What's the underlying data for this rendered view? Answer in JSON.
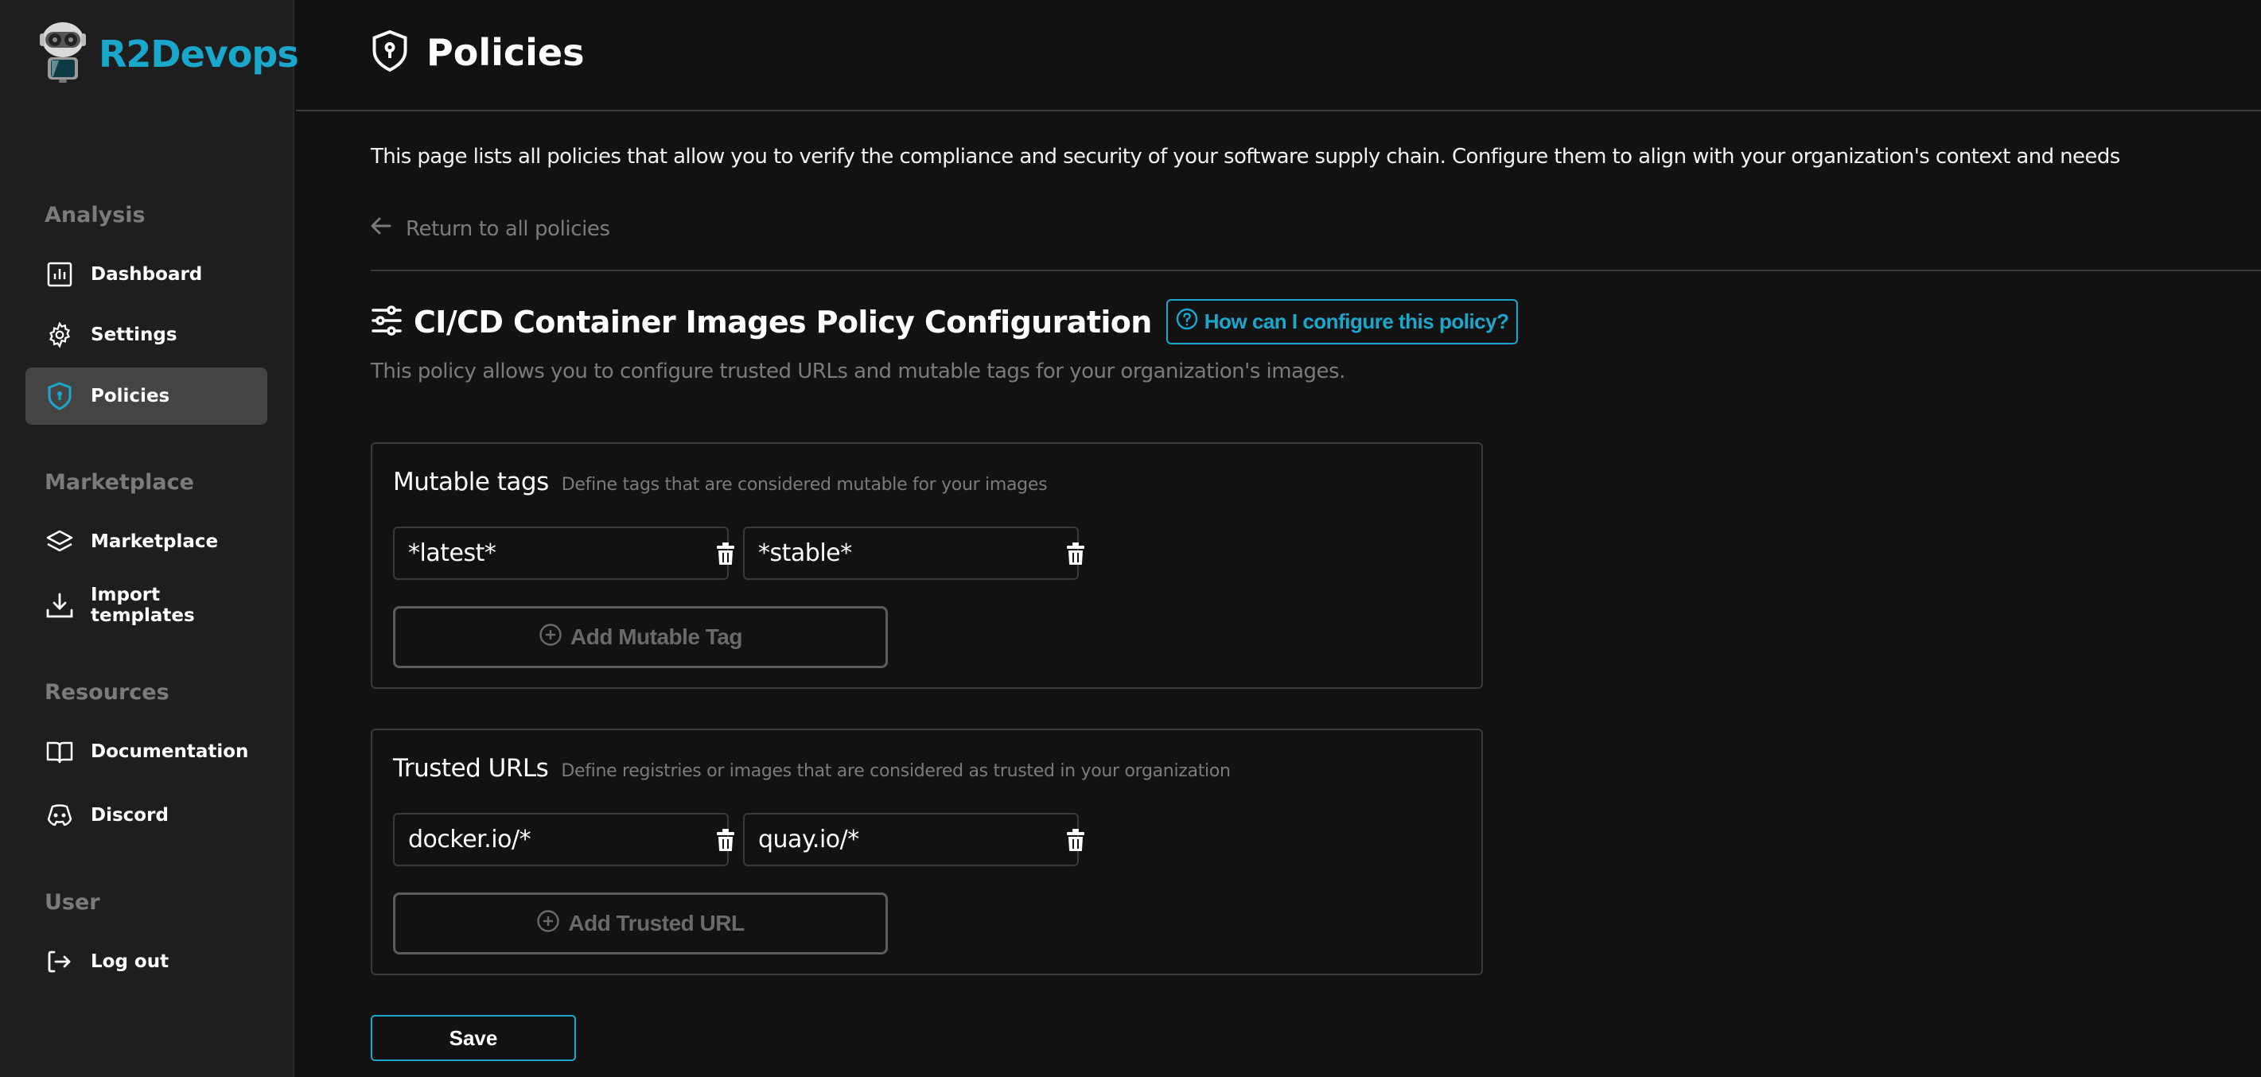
{
  "brand": {
    "name": "R2Devops",
    "accent": "#1aa7cc",
    "logo_icon": "robot-logo-icon"
  },
  "sidebar": {
    "sections": [
      {
        "title": "Analysis",
        "items": [
          {
            "label": "Dashboard",
            "icon": "bar-chart-icon",
            "active": false
          },
          {
            "label": "Settings",
            "icon": "gear-icon",
            "active": false
          },
          {
            "label": "Policies",
            "icon": "shield-lock-icon",
            "active": true
          }
        ]
      },
      {
        "title": "Marketplace",
        "items": [
          {
            "label": "Marketplace",
            "icon": "layers-icon",
            "active": false
          },
          {
            "label": "Import templates",
            "icon": "download-icon",
            "active": false
          }
        ]
      },
      {
        "title": "Resources",
        "items": [
          {
            "label": "Documentation",
            "icon": "book-icon",
            "active": false
          },
          {
            "label": "Discord",
            "icon": "discord-icon",
            "active": false
          }
        ]
      },
      {
        "title": "User",
        "items": [
          {
            "label": "Log out",
            "icon": "logout-icon",
            "active": false
          }
        ]
      }
    ]
  },
  "header": {
    "title": "Policies",
    "icon": "shield-lock-icon"
  },
  "page": {
    "description": "This page lists all policies that allow you to verify the compliance and security of your software supply chain. Configure them to align with your organization's context and needs",
    "back_link": "Return to all policies"
  },
  "policy": {
    "title": "CI/CD Container Images Policy Configuration",
    "title_icon": "sliders-icon",
    "help_button": "How can I configure this policy?",
    "subtitle": "This policy allows you to configure trusted URLs and mutable tags for your organization's images.",
    "mutable_tags": {
      "title": "Mutable tags",
      "hint": "Define tags that are considered mutable for your images",
      "values": [
        "*latest*",
        "*stable*"
      ],
      "add_label": "Add Mutable Tag"
    },
    "trusted_urls": {
      "title": "Trusted URLs",
      "hint": "Define registries or images that are considered as trusted in your organization",
      "values": [
        "docker.io/*",
        "quay.io/*"
      ],
      "add_label": "Add Trusted URL"
    },
    "save_label": "Save"
  }
}
